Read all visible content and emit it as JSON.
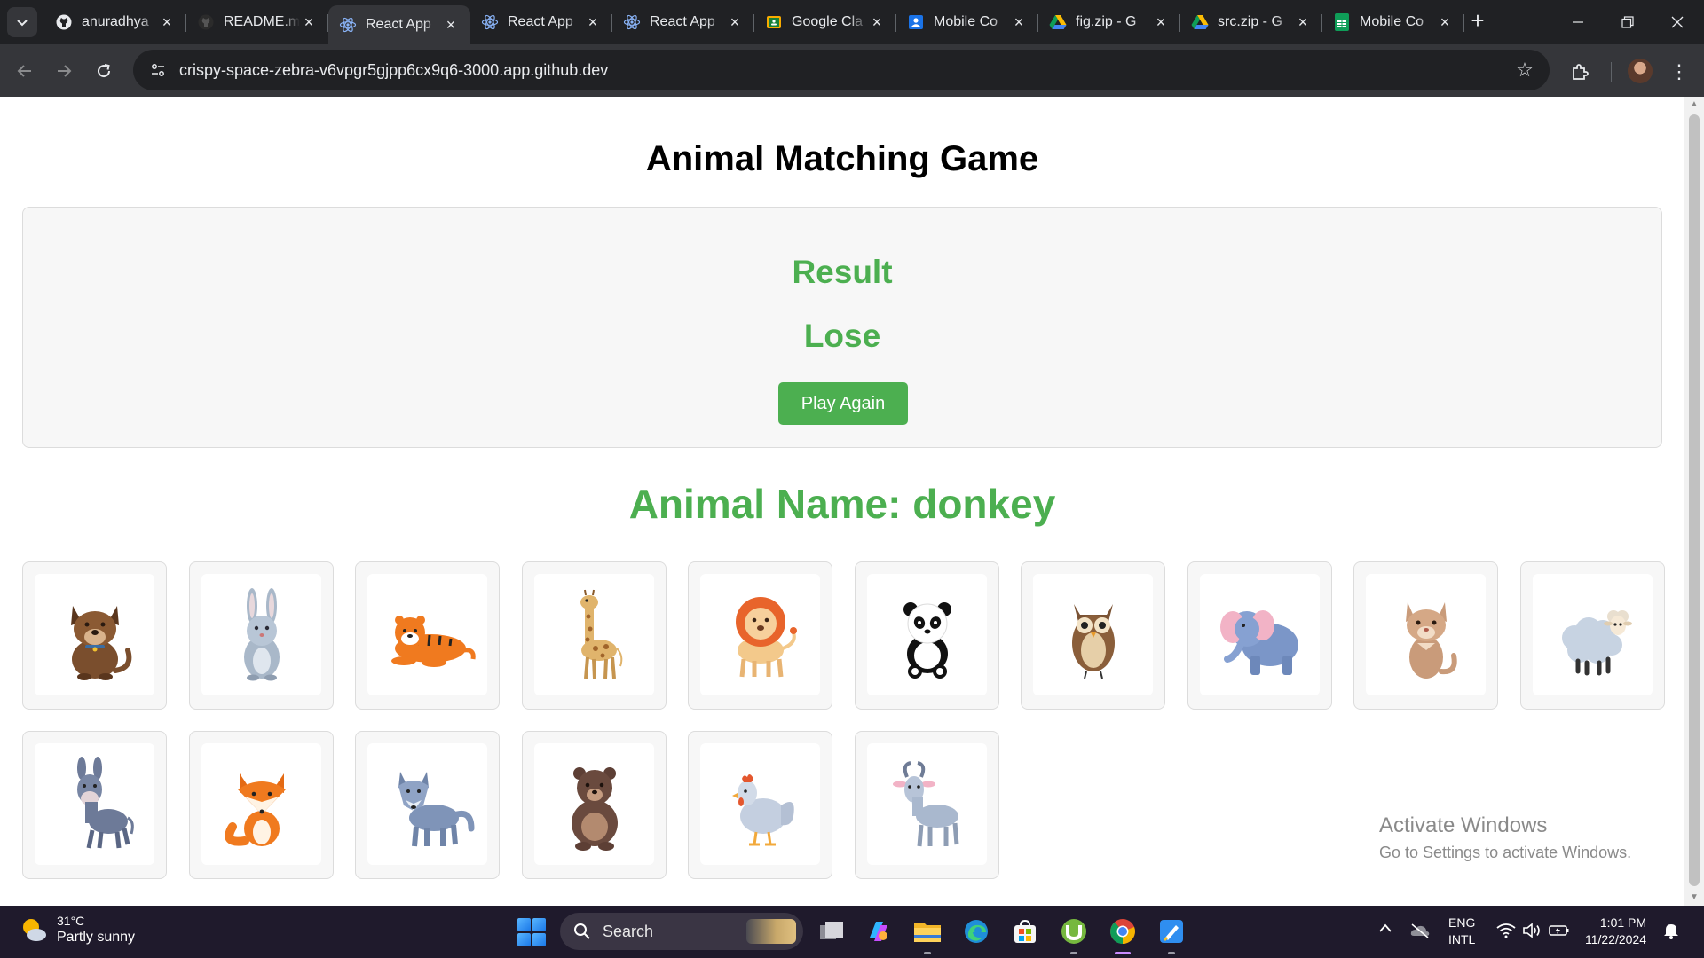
{
  "browser": {
    "tabs": [
      {
        "title": "anuradhya",
        "favicon": "github-icon"
      },
      {
        "title": "README.m",
        "favicon": "github-icon"
      },
      {
        "title": "React App",
        "favicon": "react-icon",
        "active": true
      },
      {
        "title": "React App",
        "favicon": "react-icon"
      },
      {
        "title": "React App",
        "favicon": "react-icon"
      },
      {
        "title": "Google Cla",
        "favicon": "google-classroom-icon"
      },
      {
        "title": "Mobile Co",
        "favicon": "contacts-icon"
      },
      {
        "title": "fig.zip - G",
        "favicon": "google-drive-icon"
      },
      {
        "title": "src.zip - G",
        "favicon": "google-drive-icon"
      },
      {
        "title": "Mobile Co",
        "favicon": "google-sheets-icon"
      }
    ],
    "url": "crispy-space-zebra-v6vpgr5gjpp6cx9q6-3000.app.github.dev"
  },
  "page": {
    "title": "Animal Matching Game",
    "result_heading": "Result",
    "result_value": "Lose",
    "play_again_label": "Play Again",
    "animal_name_label": "Animal Name: donkey",
    "animals": [
      "dog",
      "rabbit",
      "tiger",
      "giraffe",
      "lion",
      "panda",
      "owl",
      "elephant",
      "cat",
      "sheep",
      "donkey",
      "fox",
      "wolf",
      "bear",
      "hen",
      "goat"
    ],
    "accent_color": "#4caf50"
  },
  "watermark": {
    "line1": "Activate Windows",
    "line2": "Go to Settings to activate Windows."
  },
  "taskbar": {
    "weather_temp": "31°C",
    "weather_condition": "Partly sunny",
    "search_placeholder": "Search",
    "lang_line1": "ENG",
    "lang_line2": "INTL",
    "time": "1:01 PM",
    "date": "11/22/2024"
  }
}
